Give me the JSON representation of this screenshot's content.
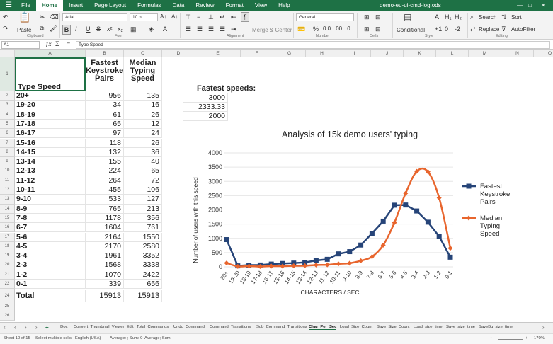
{
  "menubar": {
    "items": [
      "File",
      "Home",
      "Insert",
      "Page Layout",
      "Formulas",
      "Data",
      "Review",
      "Format",
      "View",
      "Help"
    ],
    "active": "Home",
    "doc_title": "demo-eu-ui-cmd-log.ods"
  },
  "ribbon": {
    "paste_label": "Paste",
    "font_name": "Arial",
    "font_size": "10 pt",
    "number_format": "General",
    "merge_label": "Merge & Center",
    "conditional_label": "Conditional",
    "search_label": "Search",
    "sort_label": "Sort",
    "replace_label": "Replace",
    "autofilter_label": "AutoFilter",
    "groups": [
      "Clipboard",
      "Font",
      "Alignment",
      "Number",
      "Cells",
      "Style",
      "Editing"
    ]
  },
  "formula_bar": {
    "cell_ref": "A1",
    "content": "Type Speed"
  },
  "columns": [
    "A",
    "B",
    "C",
    "D",
    "E",
    "F",
    "G",
    "H",
    "I",
    "J",
    "K",
    "L",
    "M",
    "N",
    "O"
  ],
  "rows": [
    "1",
    "2",
    "3",
    "4",
    "5",
    "6",
    "7",
    "8",
    "9",
    "10",
    "11",
    "12",
    "13",
    "14",
    "15",
    "16",
    "17",
    "18",
    "19",
    "20",
    "21",
    "22",
    "23",
    "24",
    "25",
    "26"
  ],
  "sheet": {
    "header_a": "Type Speed",
    "header_b": "Fastest Keystroke Pairs",
    "header_c": "Median Typing Speed",
    "fastest_label": "Fastest speeds:",
    "fastest_values": [
      "3000",
      "2333.33",
      "2000"
    ],
    "data_rows": [
      {
        "type": "20+",
        "fastest": "956",
        "median": "135"
      },
      {
        "type": "19-20",
        "fastest": "34",
        "median": "16"
      },
      {
        "type": "18-19",
        "fastest": "61",
        "median": "26"
      },
      {
        "type": "17-18",
        "fastest": "65",
        "median": "12"
      },
      {
        "type": "16-17",
        "fastest": "97",
        "median": "24"
      },
      {
        "type": "15-16",
        "fastest": "118",
        "median": "26"
      },
      {
        "type": "14-15",
        "fastest": "132",
        "median": "36"
      },
      {
        "type": "13-14",
        "fastest": "155",
        "median": "40"
      },
      {
        "type": "12-13",
        "fastest": "224",
        "median": "65"
      },
      {
        "type": "11-12",
        "fastest": "264",
        "median": "72"
      },
      {
        "type": "10-11",
        "fastest": "455",
        "median": "106"
      },
      {
        "type": "9-10",
        "fastest": "533",
        "median": "127"
      },
      {
        "type": "8-9",
        "fastest": "765",
        "median": "213"
      },
      {
        "type": "7-8",
        "fastest": "1178",
        "median": "356"
      },
      {
        "type": "6-7",
        "fastest": "1604",
        "median": "761"
      },
      {
        "type": "5-6",
        "fastest": "2164",
        "median": "1550"
      },
      {
        "type": "4-5",
        "fastest": "2170",
        "median": "2580"
      },
      {
        "type": "3-4",
        "fastest": "1961",
        "median": "3352"
      },
      {
        "type": "2-3",
        "fastest": "1568",
        "median": "3338"
      },
      {
        "type": "1-2",
        "fastest": "1070",
        "median": "2422"
      },
      {
        "type": "0-1",
        "fastest": "339",
        "median": "656"
      }
    ],
    "total_label": "Total",
    "total_fastest": "15913",
    "total_median": "15913"
  },
  "chart_data": {
    "type": "line",
    "title": "Analysis of 15k demo users' typing",
    "xlabel": "CHARACTERS / SEC",
    "ylabel": "Number of users with this speed",
    "categories": [
      "20+",
      "19-20",
      "18-19",
      "17-18",
      "16-17",
      "15-16",
      "14-15",
      "13-14",
      "12-13",
      "11-12",
      "10-11",
      "9-10",
      "8-9",
      "7-8",
      "6-7",
      "5-6",
      "4-5",
      "3-4",
      "2-3",
      "1-2",
      "0-1"
    ],
    "ylim": [
      0,
      4000
    ],
    "yticks": [
      0,
      500,
      1000,
      1500,
      2000,
      2500,
      3000,
      3500,
      4000
    ],
    "legend_position": "right",
    "series": [
      {
        "name": "Fastest Keystroke Pairs",
        "color": "#264478",
        "marker": "square",
        "smooth": false,
        "values": [
          956,
          34,
          61,
          65,
          97,
          118,
          132,
          155,
          224,
          264,
          455,
          533,
          765,
          1178,
          1604,
          2164,
          2170,
          1961,
          1568,
          1070,
          339
        ]
      },
      {
        "name": "Median Typing Speed",
        "color": "#e8652d",
        "marker": "diamond",
        "smooth": true,
        "values": [
          135,
          16,
          26,
          12,
          24,
          26,
          36,
          40,
          65,
          72,
          106,
          127,
          213,
          356,
          761,
          1550,
          2580,
          3352,
          3338,
          2422,
          656
        ]
      }
    ],
    "legend_lines": [
      [
        "Fastest",
        "Keystroke",
        "Pairs"
      ],
      [
        "Median",
        "Typing",
        "Speed"
      ]
    ]
  },
  "sheet_tabs": {
    "tabs": [
      "r_Doc",
      "Convert_Thumbnail_Viewer_Edit",
      "Total_Commands",
      "Undo_Command",
      "Command_Transitions",
      "Sub_Command_Transitions",
      "Char_Per_Sec",
      "Load_Size_Count",
      "Save_Size_Count",
      "Load_size_time",
      "Save_size_time",
      "SaveBg_size_time"
    ],
    "active": "Char_Per_Sec"
  },
  "statusbar": {
    "sheet_info": "Sheet 10 of 15",
    "selection": "Select multiple cells",
    "language": "English (USA)",
    "average": "Average: ; Sum: 0",
    "average_sum": "Average; Sum",
    "zoom": "170%"
  }
}
